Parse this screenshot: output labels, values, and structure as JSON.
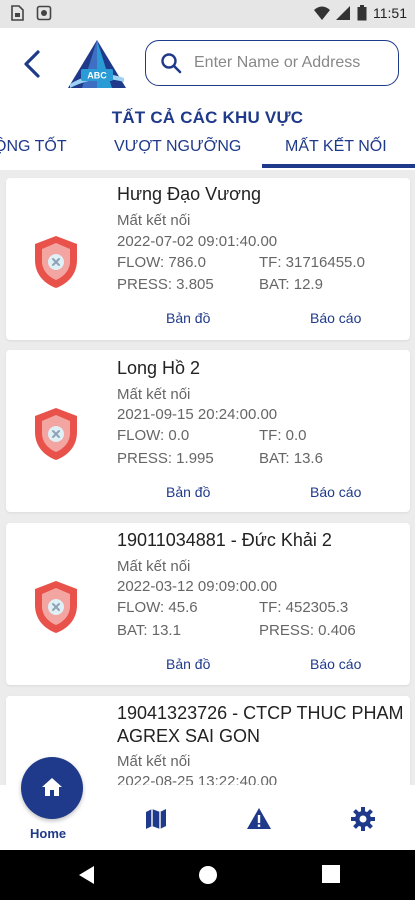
{
  "status_bar": {
    "time": "11:51",
    "icons": [
      "sim-card-icon",
      "media-icon",
      "wifi-icon",
      "signal-icon",
      "battery-icon"
    ]
  },
  "header": {
    "logo_text": "ABC",
    "search": {
      "placeholder": "Enter Name or Address",
      "value": ""
    }
  },
  "region": {
    "title": "TẤT CẢ CÁC KHU VỰC",
    "tabs": [
      {
        "label": "ỘNG TỐT",
        "active": false
      },
      {
        "label": "VƯỢT NGƯỠNG",
        "active": false
      },
      {
        "label": "MẤT KẾT NỐI",
        "active": true
      }
    ]
  },
  "stations": [
    {
      "name": "Hưng Đạo Vương",
      "status": "Mất kết nối",
      "datetime": "2022-07-02   09:01:40.00",
      "left1": "FLOW: 786.0",
      "right1": "TF: 31716455.0",
      "left2": "PRESS: 3.805",
      "right2": "BAT: 12.9",
      "map_label": "Bản đồ",
      "report_label": "Báo cáo"
    },
    {
      "name": "Long Hồ 2",
      "status": "Mất kết nối",
      "datetime": "2021-09-15   20:24:00.00",
      "left1": "FLOW: 0.0",
      "right1": "TF: 0.0",
      "left2": "PRESS: 1.995",
      "right2": "BAT: 13.6",
      "map_label": "Bản đồ",
      "report_label": "Báo cáo"
    },
    {
      "name": "19011034881 - Đức Khải 2",
      "status": "Mất kết nối",
      "datetime": "2022-03-12   09:09:00.00",
      "left1": "FLOW: 45.6",
      "right1": "TF: 452305.3",
      "left2": "BAT: 13.1",
      "right2": "PRESS: 0.406",
      "map_label": "Bản đồ",
      "report_label": "Báo cáo"
    },
    {
      "name": "19041323726 - CTCP THUC PHAM",
      "name2": "AGREX SAI GON",
      "status": "Mất kết nối",
      "datetime": "2022-08-25   13:22:40.00"
    }
  ],
  "bottom_nav": {
    "home_label": "Home",
    "items": [
      "home-icon",
      "map-icon",
      "warning-icon",
      "settings-icon"
    ]
  },
  "colors": {
    "primary": "#1f3a8a",
    "alert": "#e8524a",
    "muted_text": "#666666"
  }
}
